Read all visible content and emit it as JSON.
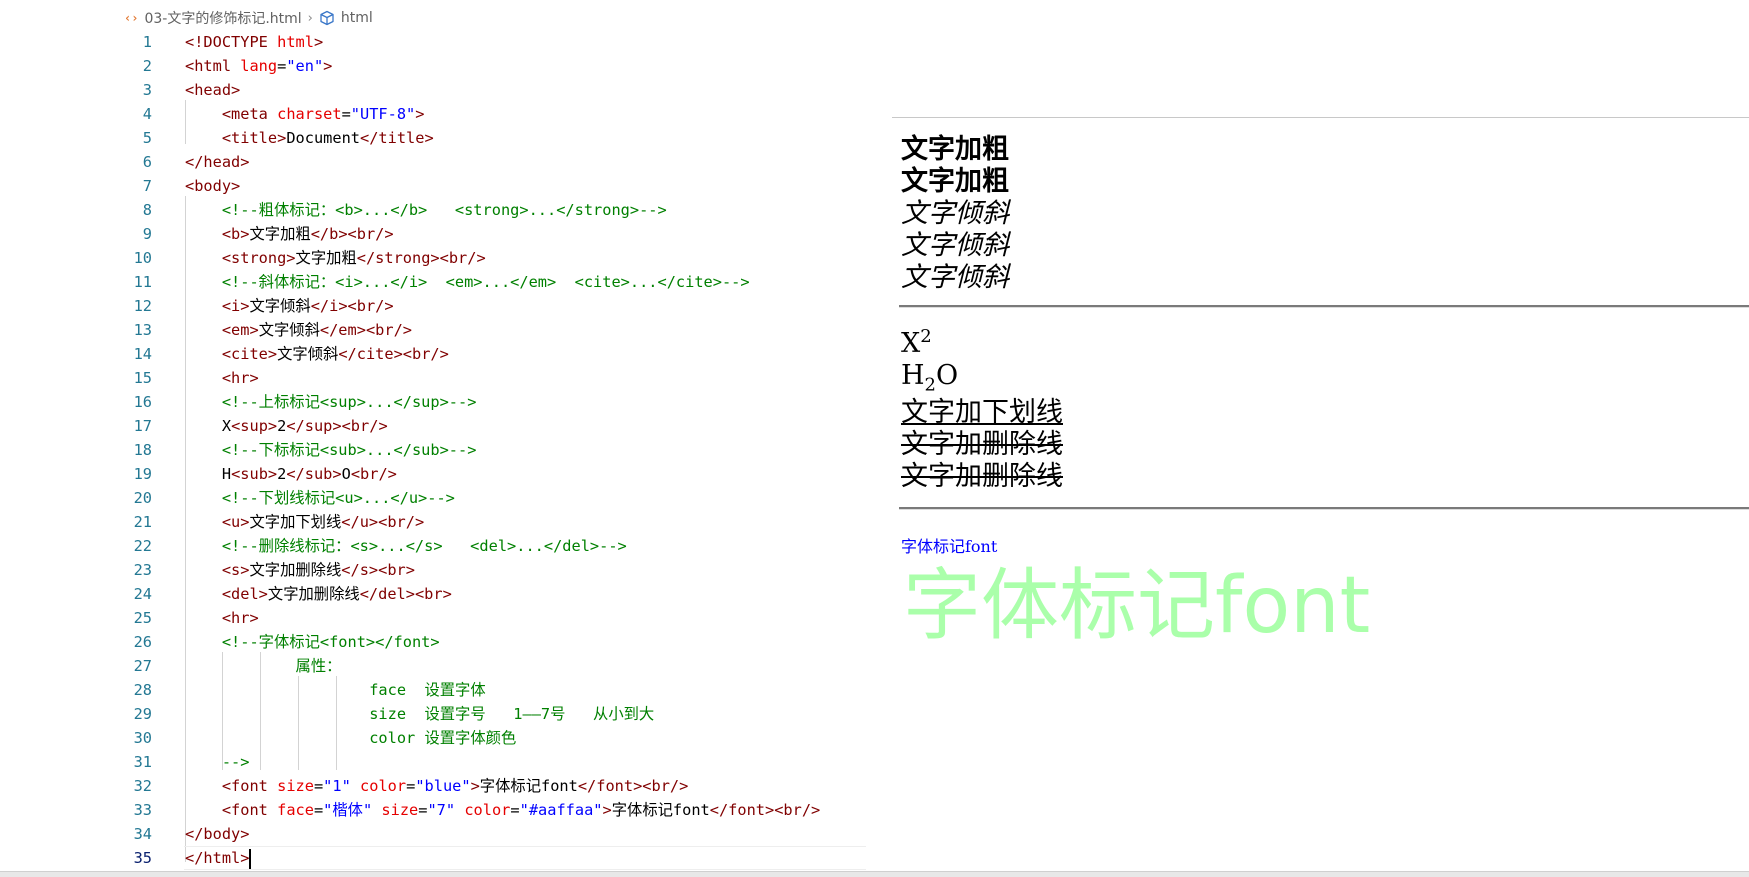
{
  "breadcrumb": {
    "file_icon": "code-file-icon",
    "file_name": "03-文字的修饰标记.html",
    "separator_icon": "chevron-right-icon",
    "symbol_icon": "cube-icon",
    "symbol_name": "html"
  },
  "editor": {
    "active_line": 35,
    "lines": [
      {
        "n": 1,
        "tokens": [
          {
            "t": "<!DOCTYPE ",
            "c": "br"
          },
          {
            "t": "html",
            "c": "at"
          },
          {
            "t": ">",
            "c": "br"
          }
        ]
      },
      {
        "n": 2,
        "tokens": [
          {
            "t": "<html ",
            "c": "br"
          },
          {
            "t": "lang",
            "c": "at"
          },
          {
            "t": "=",
            "c": "tx"
          },
          {
            "t": "\"en\"",
            "c": "st"
          },
          {
            "t": ">",
            "c": "br"
          }
        ]
      },
      {
        "n": 3,
        "tokens": [
          {
            "t": "<head>",
            "c": "br"
          }
        ]
      },
      {
        "n": 4,
        "tokens": [
          {
            "t": "    ",
            "c": "tx"
          },
          {
            "t": "<meta ",
            "c": "br"
          },
          {
            "t": "charset",
            "c": "at"
          },
          {
            "t": "=",
            "c": "tx"
          },
          {
            "t": "\"UTF-8\"",
            "c": "st"
          },
          {
            "t": ">",
            "c": "br"
          }
        ]
      },
      {
        "n": 5,
        "tokens": [
          {
            "t": "    ",
            "c": "tx"
          },
          {
            "t": "<title>",
            "c": "br"
          },
          {
            "t": "Document",
            "c": "tx"
          },
          {
            "t": "</title>",
            "c": "br"
          }
        ]
      },
      {
        "n": 6,
        "tokens": [
          {
            "t": "</head>",
            "c": "br"
          }
        ]
      },
      {
        "n": 7,
        "tokens": [
          {
            "t": "<body>",
            "c": "br"
          }
        ]
      },
      {
        "n": 8,
        "tokens": [
          {
            "t": "    ",
            "c": "tx"
          },
          {
            "t": "<!--粗体标记：<b>...</b>   <strong>...</strong>-->",
            "c": "cm"
          }
        ]
      },
      {
        "n": 9,
        "tokens": [
          {
            "t": "    ",
            "c": "tx"
          },
          {
            "t": "<b>",
            "c": "br"
          },
          {
            "t": "文字加粗",
            "c": "tx"
          },
          {
            "t": "</b><br/>",
            "c": "br"
          }
        ]
      },
      {
        "n": 10,
        "tokens": [
          {
            "t": "    ",
            "c": "tx"
          },
          {
            "t": "<strong>",
            "c": "br"
          },
          {
            "t": "文字加粗",
            "c": "tx"
          },
          {
            "t": "</strong><br/>",
            "c": "br"
          }
        ]
      },
      {
        "n": 11,
        "tokens": [
          {
            "t": "    ",
            "c": "tx"
          },
          {
            "t": "<!--斜体标记：<i>...</i>  <em>...</em>  <cite>...</cite>-->",
            "c": "cm"
          }
        ]
      },
      {
        "n": 12,
        "tokens": [
          {
            "t": "    ",
            "c": "tx"
          },
          {
            "t": "<i>",
            "c": "br"
          },
          {
            "t": "文字倾斜",
            "c": "tx"
          },
          {
            "t": "</i><br/>",
            "c": "br"
          }
        ]
      },
      {
        "n": 13,
        "tokens": [
          {
            "t": "    ",
            "c": "tx"
          },
          {
            "t": "<em>",
            "c": "br"
          },
          {
            "t": "文字倾斜",
            "c": "tx"
          },
          {
            "t": "</em><br/>",
            "c": "br"
          }
        ]
      },
      {
        "n": 14,
        "tokens": [
          {
            "t": "    ",
            "c": "tx"
          },
          {
            "t": "<cite>",
            "c": "br"
          },
          {
            "t": "文字倾斜",
            "c": "tx"
          },
          {
            "t": "</cite><br/>",
            "c": "br"
          }
        ]
      },
      {
        "n": 15,
        "tokens": [
          {
            "t": "    ",
            "c": "tx"
          },
          {
            "t": "<hr>",
            "c": "br"
          }
        ]
      },
      {
        "n": 16,
        "tokens": [
          {
            "t": "    ",
            "c": "tx"
          },
          {
            "t": "<!--上标标记<sup>...</sup>-->",
            "c": "cm"
          }
        ]
      },
      {
        "n": 17,
        "tokens": [
          {
            "t": "    ",
            "c": "tx"
          },
          {
            "t": "X",
            "c": "tx"
          },
          {
            "t": "<sup>",
            "c": "br"
          },
          {
            "t": "2",
            "c": "tx"
          },
          {
            "t": "</sup><br/>",
            "c": "br"
          }
        ]
      },
      {
        "n": 18,
        "tokens": [
          {
            "t": "    ",
            "c": "tx"
          },
          {
            "t": "<!--下标标记<sub>...</sub>-->",
            "c": "cm"
          }
        ]
      },
      {
        "n": 19,
        "tokens": [
          {
            "t": "    ",
            "c": "tx"
          },
          {
            "t": "H",
            "c": "tx"
          },
          {
            "t": "<sub>",
            "c": "br"
          },
          {
            "t": "2",
            "c": "tx"
          },
          {
            "t": "</sub>",
            "c": "br"
          },
          {
            "t": "O",
            "c": "tx"
          },
          {
            "t": "<br/>",
            "c": "br"
          }
        ]
      },
      {
        "n": 20,
        "tokens": [
          {
            "t": "    ",
            "c": "tx"
          },
          {
            "t": "<!--下划线标记<u>...</u>-->",
            "c": "cm"
          }
        ]
      },
      {
        "n": 21,
        "tokens": [
          {
            "t": "    ",
            "c": "tx"
          },
          {
            "t": "<u>",
            "c": "br"
          },
          {
            "t": "文字加下划线",
            "c": "tx"
          },
          {
            "t": "</u><br/>",
            "c": "br"
          }
        ]
      },
      {
        "n": 22,
        "tokens": [
          {
            "t": "    ",
            "c": "tx"
          },
          {
            "t": "<!--删除线标记：<s>...</s>   <del>...</del>-->",
            "c": "cm"
          }
        ]
      },
      {
        "n": 23,
        "tokens": [
          {
            "t": "    ",
            "c": "tx"
          },
          {
            "t": "<s>",
            "c": "br"
          },
          {
            "t": "文字加删除线",
            "c": "tx"
          },
          {
            "t": "</s><br>",
            "c": "br"
          }
        ]
      },
      {
        "n": 24,
        "tokens": [
          {
            "t": "    ",
            "c": "tx"
          },
          {
            "t": "<del>",
            "c": "br"
          },
          {
            "t": "文字加删除线",
            "c": "tx"
          },
          {
            "t": "</del><br>",
            "c": "br"
          }
        ]
      },
      {
        "n": 25,
        "tokens": [
          {
            "t": "    ",
            "c": "tx"
          },
          {
            "t": "<hr>",
            "c": "br"
          }
        ]
      },
      {
        "n": 26,
        "tokens": [
          {
            "t": "    ",
            "c": "tx"
          },
          {
            "t": "<!--字体标记<font></font>",
            "c": "cm"
          }
        ]
      },
      {
        "n": 27,
        "tokens": [
          {
            "t": "            ",
            "c": "tx"
          },
          {
            "t": "属性：",
            "c": "cm"
          }
        ]
      },
      {
        "n": 28,
        "tokens": [
          {
            "t": "                    ",
            "c": "tx"
          },
          {
            "t": "face  设置字体",
            "c": "cm"
          }
        ]
      },
      {
        "n": 29,
        "tokens": [
          {
            "t": "                    ",
            "c": "tx"
          },
          {
            "t": "size  设置字号   1——7号   从小到大",
            "c": "cm"
          }
        ]
      },
      {
        "n": 30,
        "tokens": [
          {
            "t": "                    ",
            "c": "tx"
          },
          {
            "t": "color 设置字体颜色",
            "c": "cm"
          }
        ]
      },
      {
        "n": 31,
        "tokens": [
          {
            "t": "    ",
            "c": "tx"
          },
          {
            "t": "-->",
            "c": "cm"
          }
        ]
      },
      {
        "n": 32,
        "tokens": [
          {
            "t": "    ",
            "c": "tx"
          },
          {
            "t": "<font ",
            "c": "br"
          },
          {
            "t": "size",
            "c": "at"
          },
          {
            "t": "=",
            "c": "tx"
          },
          {
            "t": "\"1\"",
            "c": "st"
          },
          {
            "t": " ",
            "c": "tx"
          },
          {
            "t": "color",
            "c": "at"
          },
          {
            "t": "=",
            "c": "tx"
          },
          {
            "t": "\"blue\"",
            "c": "st"
          },
          {
            "t": ">",
            "c": "br"
          },
          {
            "t": "字体标记font",
            "c": "tx"
          },
          {
            "t": "</font><br/>",
            "c": "br"
          }
        ]
      },
      {
        "n": 33,
        "tokens": [
          {
            "t": "    ",
            "c": "tx"
          },
          {
            "t": "<font ",
            "c": "br"
          },
          {
            "t": "face",
            "c": "at"
          },
          {
            "t": "=",
            "c": "tx"
          },
          {
            "t": "\"楷体\"",
            "c": "st"
          },
          {
            "t": " ",
            "c": "tx"
          },
          {
            "t": "size",
            "c": "at"
          },
          {
            "t": "=",
            "c": "tx"
          },
          {
            "t": "\"7\"",
            "c": "st"
          },
          {
            "t": " ",
            "c": "tx"
          },
          {
            "t": "color",
            "c": "at"
          },
          {
            "t": "=",
            "c": "tx"
          },
          {
            "t": "\"#aaffaa\"",
            "c": "st"
          },
          {
            "t": ">",
            "c": "br"
          },
          {
            "t": "字体标记font",
            "c": "tx"
          },
          {
            "t": "</font><br/>",
            "c": "br"
          }
        ]
      },
      {
        "n": 34,
        "tokens": [
          {
            "t": "</body>",
            "c": "br"
          }
        ]
      },
      {
        "n": 35,
        "tokens": [
          {
            "t": "</html>",
            "c": "br"
          }
        ]
      }
    ]
  },
  "preview": {
    "bold_1": "文字加粗",
    "bold_2": "文字加粗",
    "italic_1": "文字倾斜",
    "italic_2": "文字倾斜",
    "italic_3": "文字倾斜",
    "sup_base": "X",
    "sup_value": "2",
    "sub_base": "H",
    "sub_value": "2",
    "sub_tail": "O",
    "underline": "文字加下划线",
    "strike_1": "文字加删除线",
    "strike_2": "文字加删除线",
    "font_small": "字体标记font",
    "font_small_color": "#0000ff",
    "font_big": "字体标记font",
    "font_big_color": "#aaffaa"
  },
  "colors": {
    "tag_bracket": "#800000",
    "attribute": "#e50000",
    "string": "#0000ff",
    "comment": "#008000",
    "line_number": "#237893"
  }
}
